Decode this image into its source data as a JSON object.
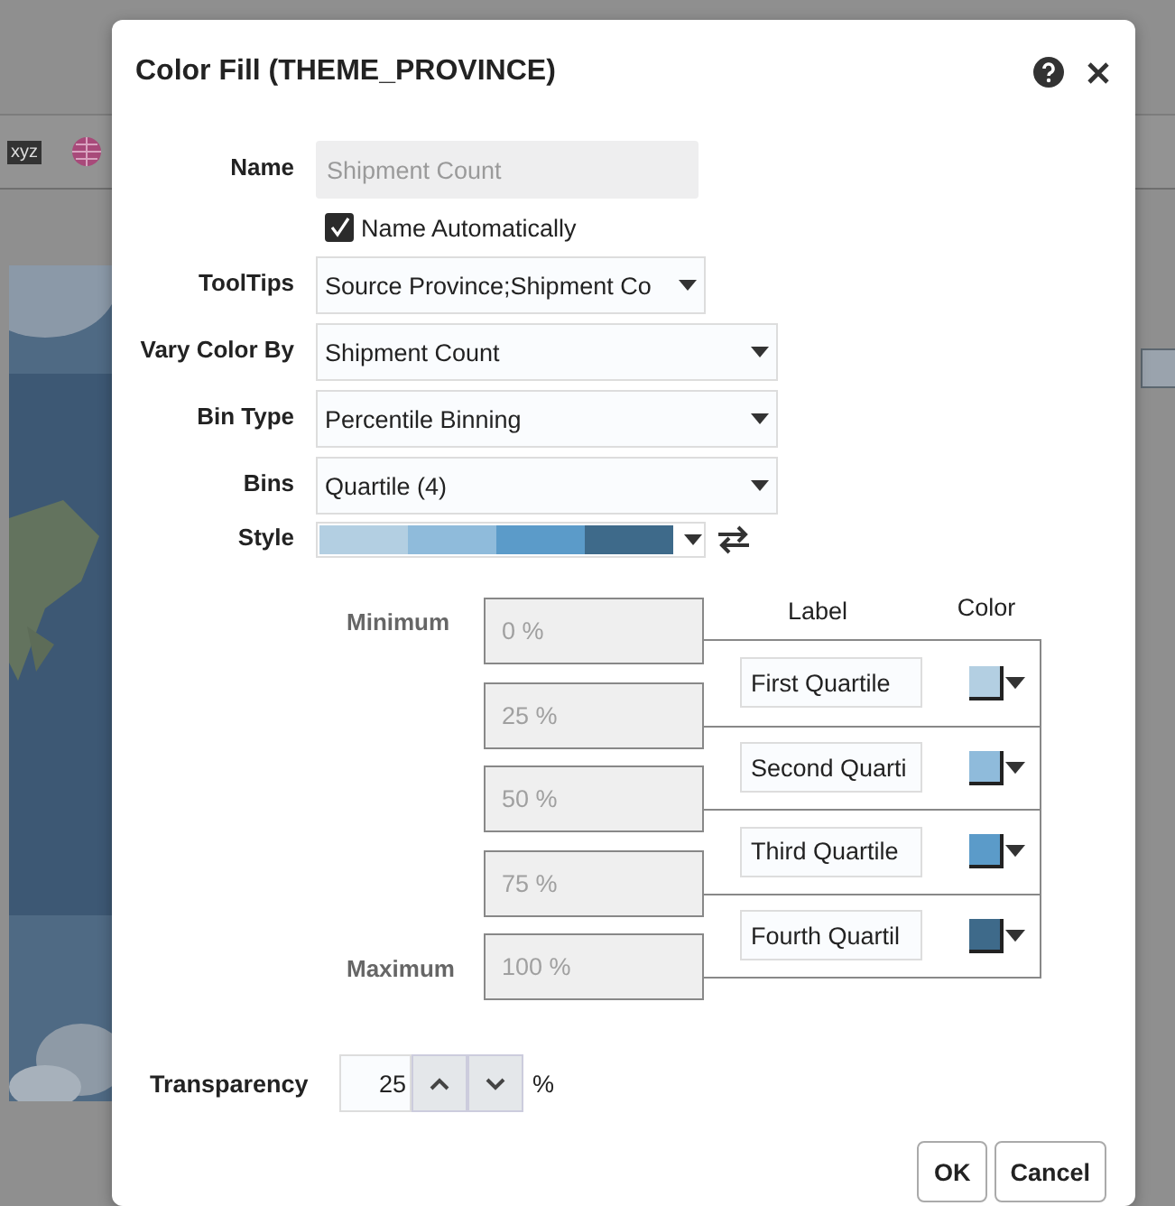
{
  "background": {
    "toolbar_label": "xyz"
  },
  "dialog": {
    "title": "Color Fill (THEME_PROVINCE)"
  },
  "name": {
    "label": "Name",
    "placeholder": "Shipment Count",
    "disabled": true
  },
  "name_automatically": {
    "label": "Name Automatically",
    "checked": true
  },
  "selects": [
    {
      "label": "ToolTips",
      "value": "Source Province;Shipment Co",
      "kind": "narrow"
    },
    {
      "label": "Vary Color By",
      "value": "Shipment Count",
      "kind": "wide"
    },
    {
      "label": "Bin Type",
      "value": "Percentile Binning",
      "kind": "wide"
    },
    {
      "label": "Bins",
      "value": "Quartile (4)",
      "kind": "wide"
    }
  ],
  "style": {
    "label": "Style",
    "segments": [
      {
        "color": "#b3cfe2"
      },
      {
        "color": "#8fbbdb"
      },
      {
        "color": "#5b9bc9"
      },
      {
        "color": "#3e6a8a"
      }
    ]
  },
  "bins": {
    "minimum_label": "Minimum",
    "maximum_label": "Maximum",
    "label_header": "Label",
    "color_header": "Color",
    "bounds": [
      {
        "placeholder": "0 %"
      },
      {
        "placeholder": "25 %"
      },
      {
        "placeholder": "50 %"
      },
      {
        "placeholder": "75 %"
      },
      {
        "placeholder": "100 %"
      }
    ],
    "rows": [
      {
        "label": "First Quartile",
        "color": "#b3cfe2"
      },
      {
        "label": "Second Quarti",
        "color": "#8fbbdb"
      },
      {
        "label": "Third Quartile",
        "color": "#5b9bc9"
      },
      {
        "label": "Fourth Quartil",
        "color": "#3e6a8a"
      }
    ]
  },
  "transparency": {
    "label": "Transparency",
    "value": "25",
    "unit": "%"
  },
  "buttons": [
    "OK",
    "Cancel"
  ]
}
